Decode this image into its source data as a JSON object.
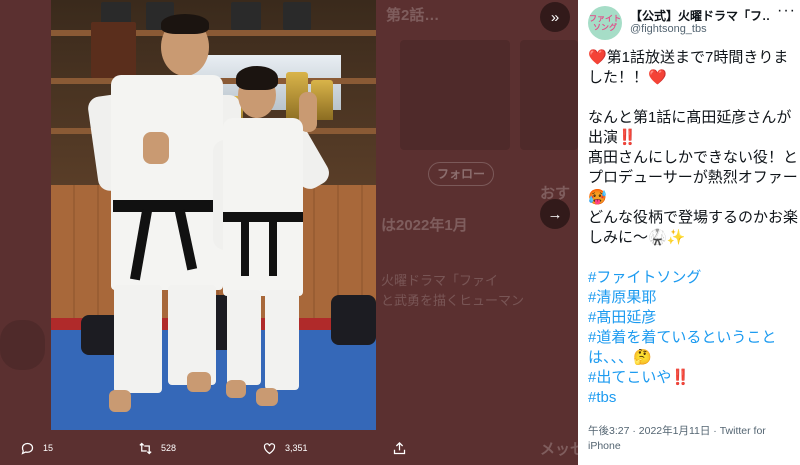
{
  "backdrop": {
    "heading": "第2話…",
    "follow_button": "フォロー",
    "date_text": "は2022年1月",
    "faint_line1": "火曜ドラマ「ファイ",
    "faint_line2": "と武勇を描くヒューマン",
    "right_label": "おす",
    "meta_label": "メッセ"
  },
  "tweet": {
    "avatar_text": "ファイトソング",
    "account_name": "【公式】火曜ドラマ「フ…",
    "handle": "@fightsong_tbs",
    "line1": "❤️第1話放送まで7時間きりました！！❤️",
    "line2": "なんと第1話に髙田延彦さんが出演‼️",
    "line3": "髙田さんにしかできない役！とプロデューサーが熱烈オファー🥵",
    "line4": "どんな役柄で登場するのかお楽しみに〜🥋✨",
    "hashtags": [
      "#ファイトソング",
      "#清原果耶",
      "#髙田延彦",
      "#道着を着ているということは、、、🤔",
      "#出てこいや‼️",
      "#tbs"
    ],
    "timestamp": "午後3:27 · 2022年1月11日 · Twitter for iPhone"
  },
  "actions": {
    "reply_count": "15",
    "retweet_count": "528",
    "like_count": "3,351"
  },
  "icons": [
    "expand-icon",
    "more-icon",
    "reply-icon",
    "retweet-icon",
    "like-icon",
    "share-icon",
    "next-arrow-icon"
  ],
  "colors": {
    "accent": "#1d9bf0",
    "text": "#0f1419",
    "muted": "#536471"
  }
}
